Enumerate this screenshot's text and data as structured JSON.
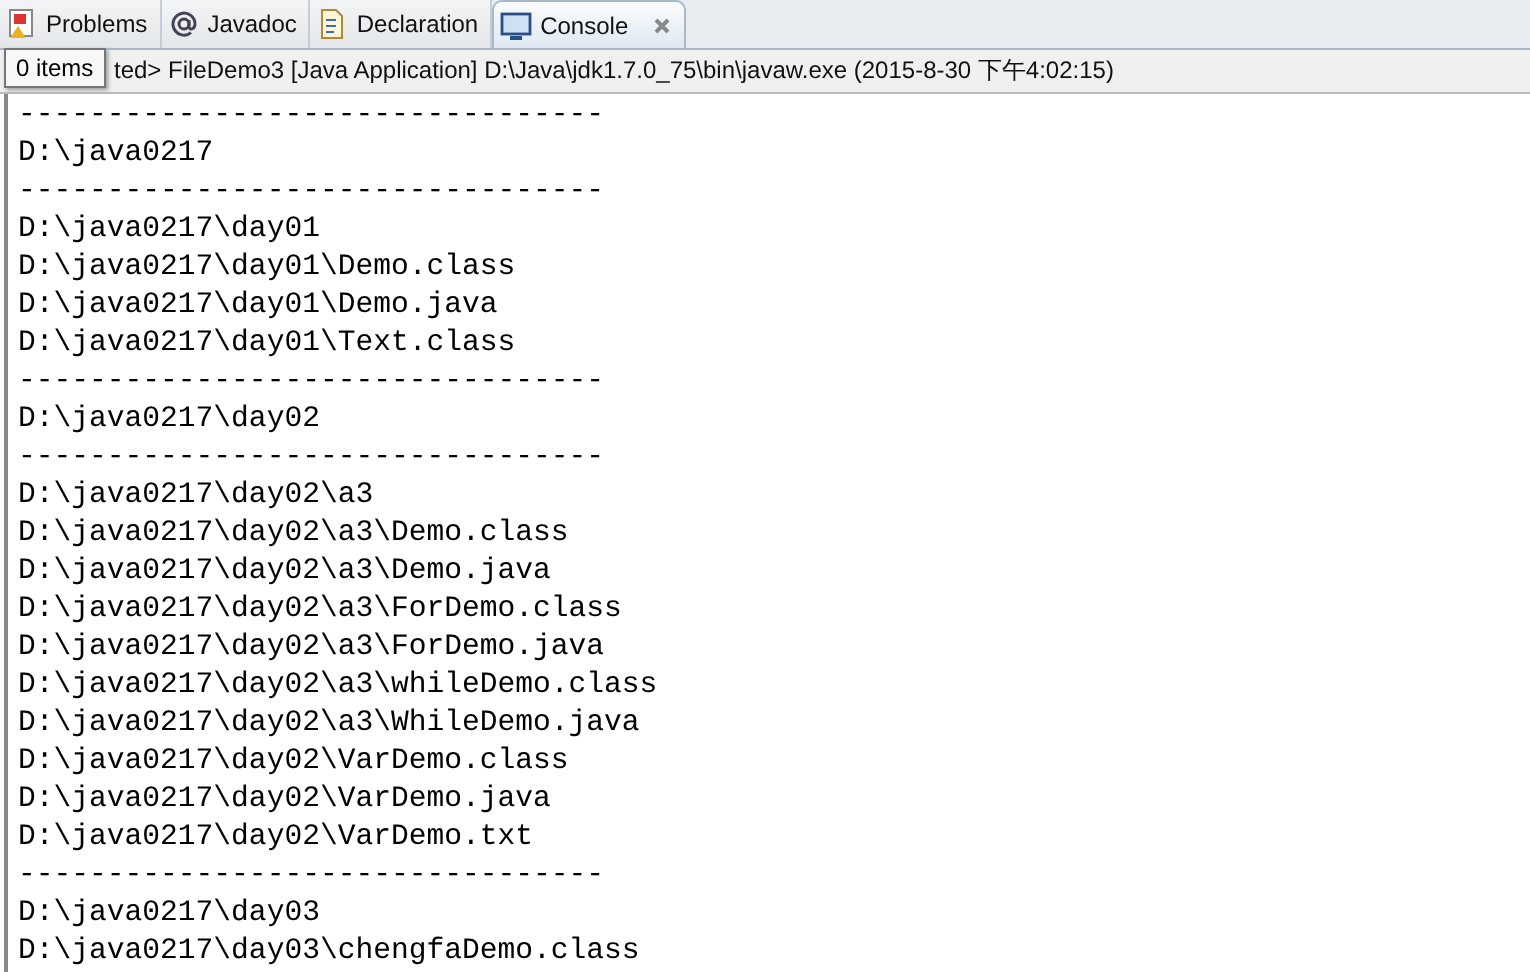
{
  "tabs": [
    {
      "label": "Problems",
      "kind": "problems",
      "selected": false,
      "closable": false
    },
    {
      "label": "Javadoc",
      "kind": "javadoc",
      "selected": false,
      "closable": false
    },
    {
      "label": "Declaration",
      "kind": "declaration",
      "selected": false,
      "closable": false
    },
    {
      "label": "Console",
      "kind": "console",
      "selected": true,
      "closable": true
    }
  ],
  "status": "ted> FileDemo3 [Java Application] D:\\Java\\jdk1.7.0_75\\bin\\javaw.exe (2015-8-30 下午4:02:15)",
  "tooltip": "0 items",
  "console_lines": [
    "---------------------------------",
    "D:\\java0217",
    "---------------------------------",
    "D:\\java0217\\day01",
    "D:\\java0217\\day01\\Demo.class",
    "D:\\java0217\\day01\\Demo.java",
    "D:\\java0217\\day01\\Text.class",
    "---------------------------------",
    "D:\\java0217\\day02",
    "---------------------------------",
    "D:\\java0217\\day02\\a3",
    "D:\\java0217\\day02\\a3\\Demo.class",
    "D:\\java0217\\day02\\a3\\Demo.java",
    "D:\\java0217\\day02\\a3\\ForDemo.class",
    "D:\\java0217\\day02\\a3\\ForDemo.java",
    "D:\\java0217\\day02\\a3\\whileDemo.class",
    "D:\\java0217\\day02\\a3\\WhileDemo.java",
    "D:\\java0217\\day02\\VarDemo.class",
    "D:\\java0217\\day02\\VarDemo.java",
    "D:\\java0217\\day02\\VarDemo.txt",
    "---------------------------------",
    "D:\\java0217\\day03",
    "D:\\java0217\\day03\\chengfaDemo.class"
  ]
}
